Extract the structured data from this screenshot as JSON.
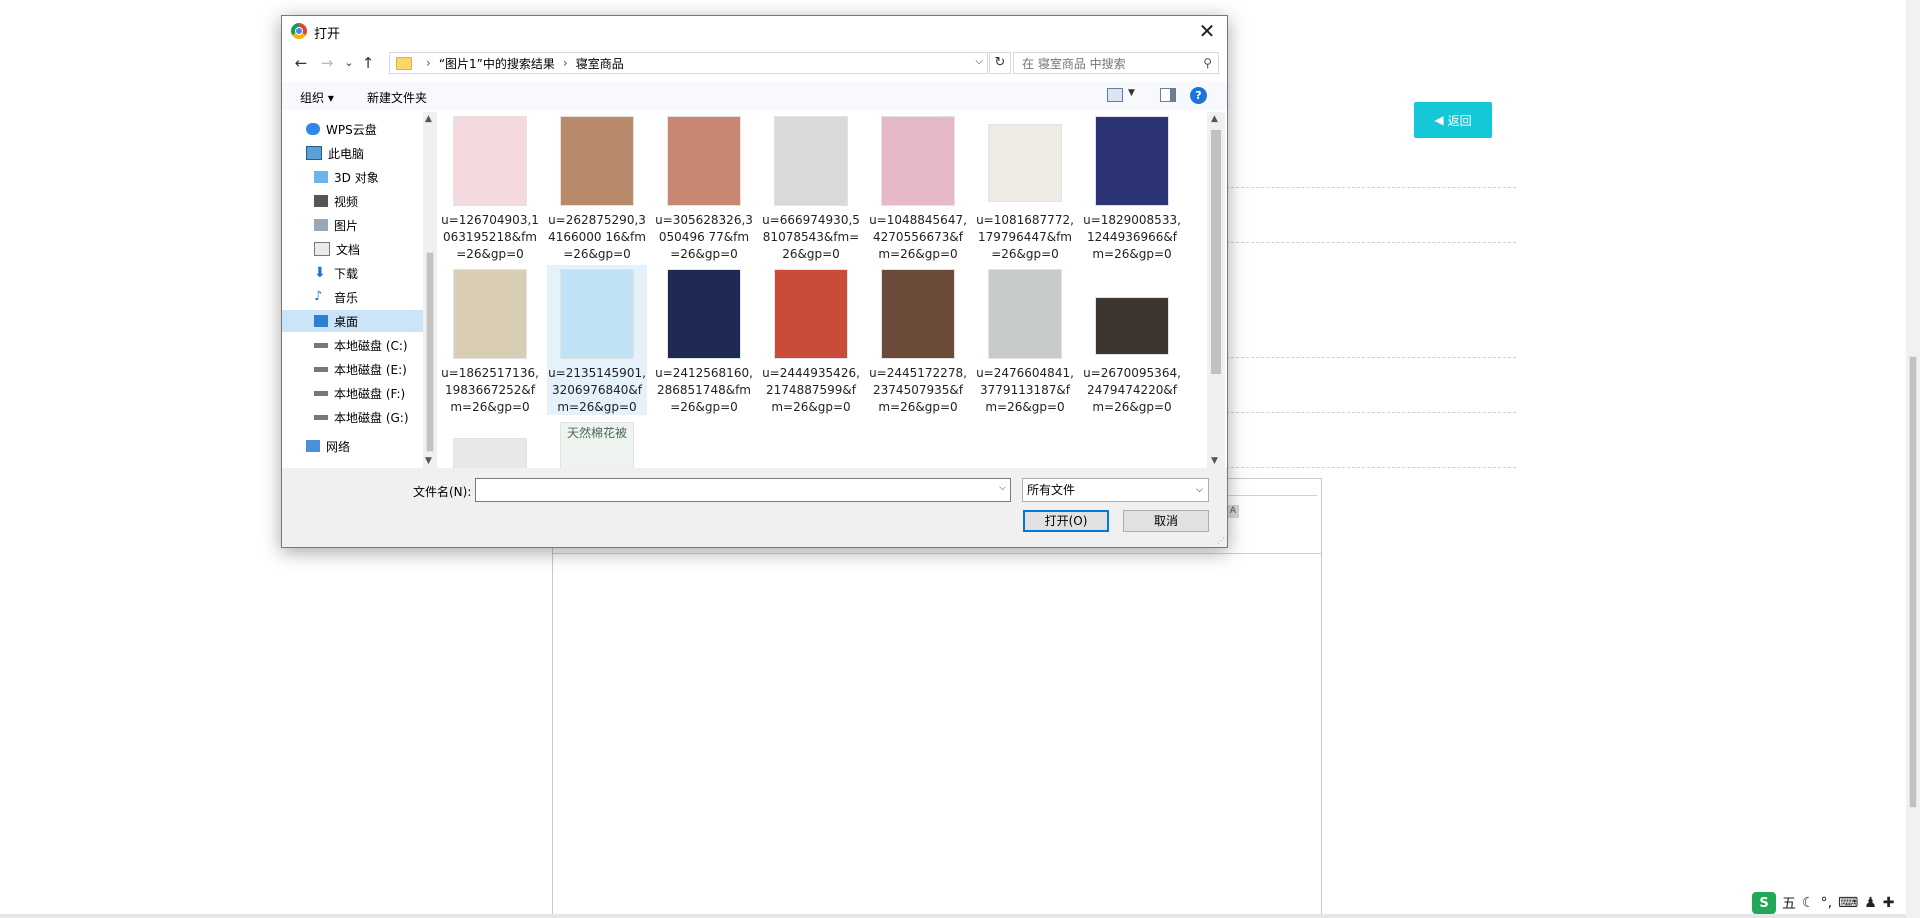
{
  "background": {
    "back_button_label": "返回",
    "editor_icon": "A"
  },
  "dialog": {
    "title": "打开",
    "close": "✕",
    "nav": {
      "back": "←",
      "forward": "→",
      "recent": "⌄",
      "up": "↑"
    },
    "breadcrumb": [
      "“图片1”中的搜索结果",
      "寝室商品"
    ],
    "refresh": "↻",
    "search_placeholder": "在 寝室商品 中搜索",
    "toolbar": {
      "organize": "组织 ▾",
      "new_folder": "新建文件夹",
      "help": "?"
    },
    "nav_items": [
      {
        "label": "WPS云盘",
        "icon": "cloud-icon"
      },
      {
        "label": "此电脑",
        "icon": "computer-icon"
      },
      {
        "label": "3D 对象",
        "icon": "3d-objects-icon"
      },
      {
        "label": "视频",
        "icon": "video-icon"
      },
      {
        "label": "图片",
        "icon": "pictures-icon"
      },
      {
        "label": "文档",
        "icon": "documents-icon"
      },
      {
        "label": "下载",
        "icon": "download-icon"
      },
      {
        "label": "音乐",
        "icon": "music-icon"
      },
      {
        "label": "桌面",
        "icon": "desktop-icon"
      },
      {
        "label": "本地磁盘 (C:)",
        "icon": "drive-icon"
      },
      {
        "label": "本地磁盘 (E:)",
        "icon": "drive-icon"
      },
      {
        "label": "本地磁盘 (F:)",
        "icon": "drive-icon"
      },
      {
        "label": "本地磁盘 (G:)",
        "icon": "drive-icon"
      },
      {
        "label": "网络",
        "icon": "network-icon"
      }
    ],
    "files": [
      {
        "name": "u=126704903,1063195218&fm=26&gp=0",
        "color": "#f4d9df"
      },
      {
        "name": "u=262875290,34166000 16&fm=26&gp=0",
        "color": "#b8896a"
      },
      {
        "name": "u=305628326,3050496 77&fm=26&gp=0",
        "color": "#c98673"
      },
      {
        "name": "u=666974930,581078543&fm=26&gp=0",
        "color": "#d9d9d9"
      },
      {
        "name": "u=1048845647,4270556673&fm=26&gp=0",
        "color": "#e6b8c8"
      },
      {
        "name": "u=1081687772,179796447&fm=26&gp=0",
        "color": "#eeeae4"
      },
      {
        "name": "u=1829008533,1244936966&fm=26&gp=0",
        "color": "#2c3475"
      },
      {
        "name": "u=1862517136,1983667252&fm=26&gp=0",
        "color": "#d9cdb6"
      },
      {
        "name": "u=2135145901,3206976840&fm=26&gp=0",
        "color": "#bfe3f5"
      },
      {
        "name": "u=2412568160,286851748&fm=26&gp=0",
        "color": "#1e2a54"
      },
      {
        "name": "u=2444935426,2174887599&fm=26&gp=0",
        "color": "#c94b3a"
      },
      {
        "name": "u=2445172278,2374507935&fm=26&gp=0",
        "color": "#6b4a3a"
      },
      {
        "name": "u=2476604841,3779113187&fm=26&gp=0",
        "color": "#c8ccc8"
      },
      {
        "name": "u=2670095364,2479474220&fm=26&gp=0",
        "color": "#3d3530"
      },
      {
        "name": "",
        "color": "#e8e8e8"
      },
      {
        "name": "天然棉花被",
        "color": "#eef3ef"
      }
    ],
    "filename_label": "文件名(N):",
    "filename_value": "",
    "filetype": "所有文件",
    "open_button": "打开(O)",
    "cancel_button": "取消"
  },
  "ime": {
    "logo": "S",
    "mode": "五",
    "items": [
      "☾",
      "°,",
      "⌨",
      "♟",
      "✚"
    ]
  }
}
